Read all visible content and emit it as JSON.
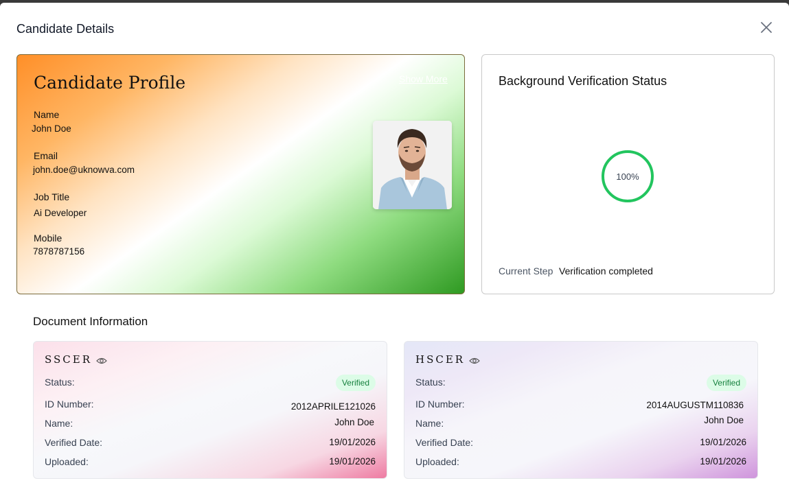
{
  "modal": {
    "title": "Candidate Details"
  },
  "profile": {
    "heading": "Candidate Profile",
    "show_more": "Show More",
    "fields": [
      {
        "label": "Name",
        "value": "John Doe"
      },
      {
        "label": "Email",
        "value": "john.doe@uknowva.com"
      },
      {
        "label": "Job Title",
        "value": "Ai Developer"
      },
      {
        "label": "Mobile",
        "value": "7878787156"
      }
    ]
  },
  "verification": {
    "title": "Background Verification Status",
    "progress_value": 100,
    "progress_text": "100%",
    "current_step_label": "Current Step",
    "current_step_value": "Verification completed"
  },
  "documents": {
    "title": "Document Information",
    "items": [
      {
        "name": "SSCER",
        "status_label": "Status:",
        "status": "Verified",
        "id_label": "ID Number:",
        "id_number": "2012APRILE121026",
        "name_label": "Name:",
        "holder_name": "John Doe",
        "verified_label": "Verified Date:",
        "verified_date": "19/01/2026",
        "uploaded_label": "Uploaded:",
        "uploaded_date": "19/01/2026"
      },
      {
        "name": "HSCER",
        "status_label": "Status:",
        "status": "Verified",
        "id_label": "ID Number:",
        "id_number": "2014AUGUSTM110836",
        "name_label": "Name:",
        "holder_name": "John Doe",
        "verified_label": "Verified Date:",
        "verified_date": "19/01/2026",
        "uploaded_label": "Uploaded:",
        "uploaded_date": "19/01/2026"
      }
    ]
  },
  "colors": {
    "progress": "#22c55e",
    "badge_bg": "#dcfce7",
    "badge_text": "#15803d"
  },
  "icons": {
    "close": "close-icon",
    "view": "eye-icon",
    "photo": "profile-photo"
  }
}
